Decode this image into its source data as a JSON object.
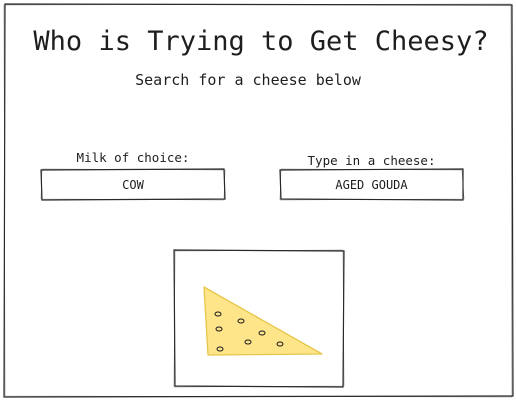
{
  "header": {
    "title": "Who is Trying to Get Cheesy?",
    "subtitle": "Search for a cheese below"
  },
  "form": {
    "milk": {
      "label": "Milk of choice:",
      "value": "COW"
    },
    "cheese": {
      "label": "Type in a cheese:",
      "value": "AGED GOUDA"
    }
  },
  "image": {
    "icon": "cheese-wedge-icon",
    "fill_color": "#ffe58a",
    "stroke_color": "#e5c64a"
  }
}
